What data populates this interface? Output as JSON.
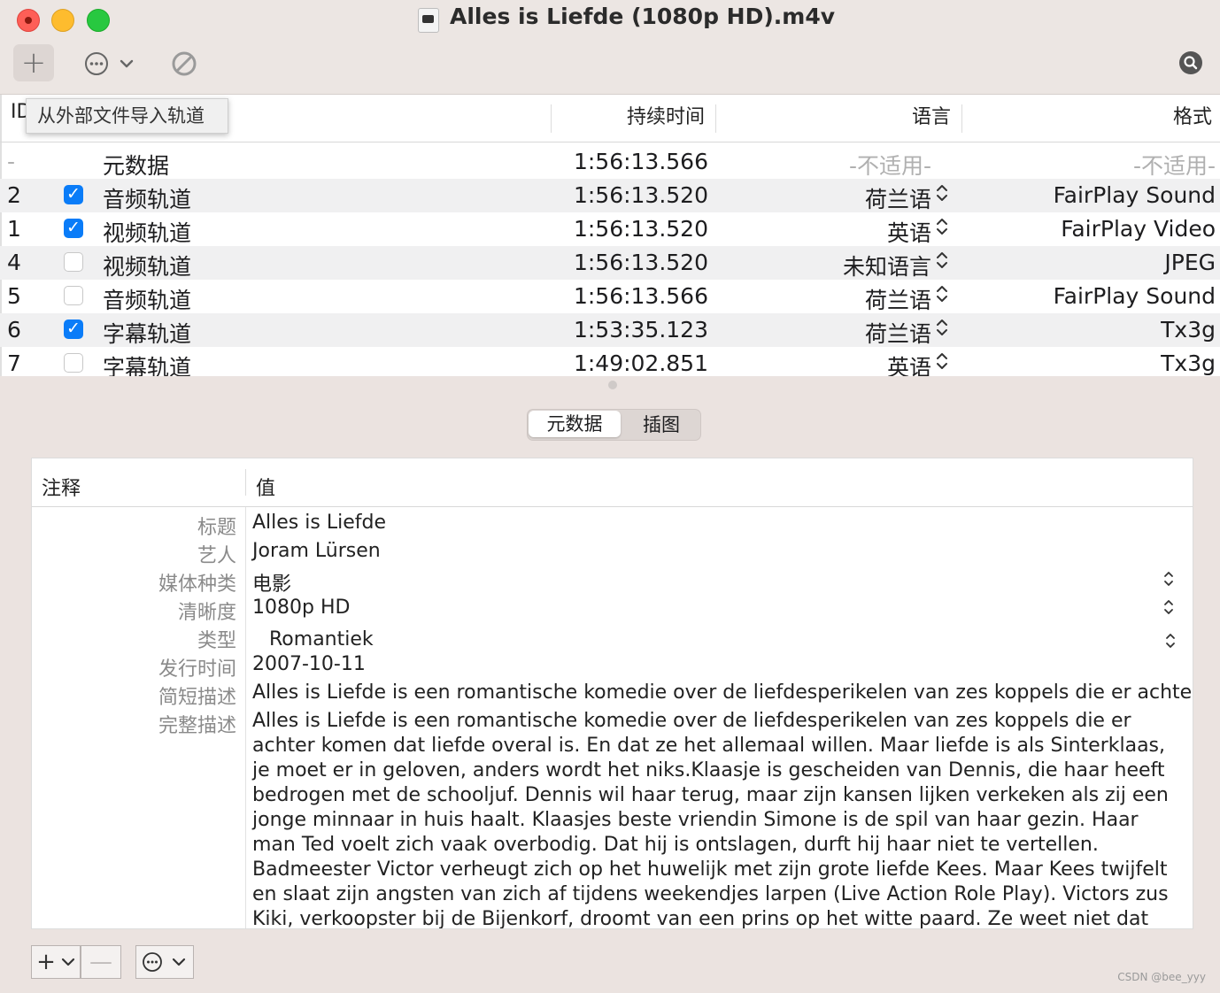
{
  "window": {
    "title": "Alles is Liefde (1080p HD).m4v"
  },
  "toolbar": {
    "add_symbol": "+",
    "tooltip": "从外部文件导入轨道"
  },
  "tracks": {
    "headers": {
      "id": "ID",
      "duration": "持续时间",
      "language": "语言",
      "format": "格式"
    },
    "rows": [
      {
        "id": "-",
        "checked": null,
        "name": "元数据",
        "duration": "1:56:13.566",
        "language": "-不适用-",
        "format": "-不适用-"
      },
      {
        "id": "2",
        "checked": true,
        "name": "音频轨道",
        "duration": "1:56:13.520",
        "language": "荷兰语",
        "format": "FairPlay Sound"
      },
      {
        "id": "1",
        "checked": true,
        "name": "视频轨道",
        "duration": "1:56:13.520",
        "language": "英语",
        "format": "FairPlay Video"
      },
      {
        "id": "4",
        "checked": false,
        "name": "视频轨道",
        "duration": "1:56:13.520",
        "language": "未知语言",
        "format": "JPEG"
      },
      {
        "id": "5",
        "checked": false,
        "name": "音频轨道",
        "duration": "1:56:13.566",
        "language": "荷兰语",
        "format": "FairPlay Sound"
      },
      {
        "id": "6",
        "checked": true,
        "name": "字幕轨道",
        "duration": "1:53:35.123",
        "language": "荷兰语",
        "format": "Tx3g"
      },
      {
        "id": "7",
        "checked": false,
        "name": "字幕轨道",
        "duration": "1:49:02.851",
        "language": "英语",
        "format": "Tx3g"
      }
    ]
  },
  "tabs": {
    "metadata": "元数据",
    "artwork": "插图"
  },
  "metadata": {
    "headers": {
      "key": "注释",
      "value": "值"
    },
    "title_key": "标题",
    "title": "Alles is Liefde",
    "artist_key": "艺人",
    "artist": "Joram Lürsen",
    "media_kind_key": "媒体种类",
    "media_kind": "电影",
    "definition_key": "清晰度",
    "definition": "1080p HD",
    "genre_key": "类型",
    "genre": "Romantiek",
    "release_key": "发行时间",
    "release": "2007-10-11",
    "short_desc_key": "简短描述",
    "short_desc": "Alles is Liefde is een romantische komedie over de liefdesperikelen van zes koppels die er achter",
    "long_desc_key": "完整描述",
    "long_desc": "Alles is Liefde is een romantische komedie over de liefdesperikelen van zes koppels die er achter komen dat liefde overal is. En dat ze het allemaal willen. Maar liefde is als Sinterklaas, je moet er in geloven, anders wordt het niks.Klaasje is gescheiden van Dennis, die haar heeft bedrogen met de schooljuf. Dennis wil haar terug, maar zijn kansen lijken verkeken als zij een jonge minnaar in huis haalt. Klaasjes beste vriendin Simone is de spil van haar gezin. Haar man Ted voelt zich vaak overbodig. Dat hij is ontslagen, durft hij haar niet te vertellen. Badmeester Victor verheugt zich op het huwelijk met zijn grote liefde Kees. Maar Kees twijfelt en slaat zijn angsten van zich af tijdens weekendjes larpen (Live Action Role Play). Victors zus Kiki, verkoopster bij de Bijenkorf, droomt van een prins op het witte paard. Ze weet niet dat een echte prins, Valentijn, van haar droomt. Met de"
  },
  "bottom_bar": {
    "add": "+",
    "remove": "—"
  },
  "watermark": "CSDN @bee_yyy",
  "colors": {
    "accent": "#0a7cf8",
    "close": "#fe5f57",
    "minimize": "#febc2e",
    "zoom": "#28c840"
  }
}
